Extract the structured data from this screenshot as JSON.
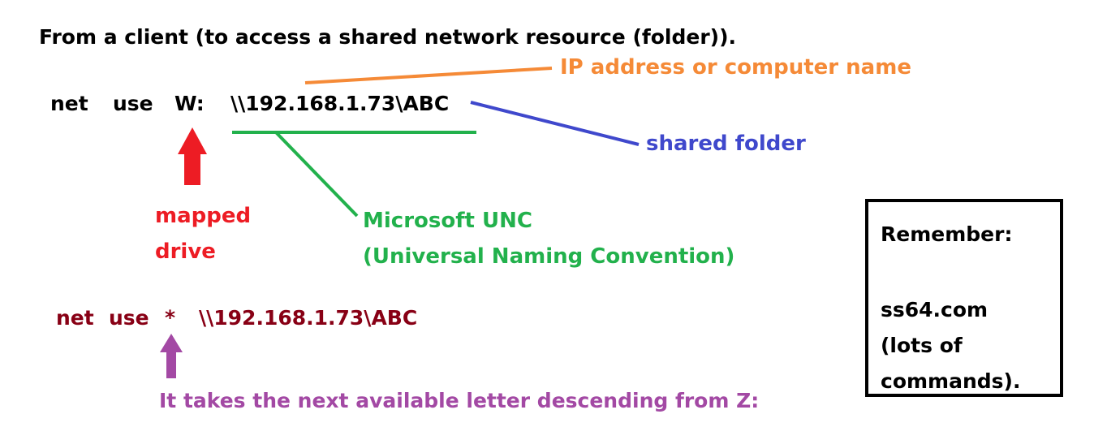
{
  "title": "From a client (to access a shared network resource (folder)).",
  "command1": {
    "net": "net",
    "use": "use",
    "drive": "W:",
    "path": "\\\\192.168.1.73\\ABC"
  },
  "annotations": {
    "ip_label": "IP address or computer name",
    "shared_folder_label": "shared folder",
    "mapped_drive_line1": "mapped",
    "mapped_drive_line2": "drive",
    "unc_line1": "Microsoft UNC",
    "unc_line2": "(Universal Naming Convention)"
  },
  "command2": {
    "net": "net",
    "use": "use",
    "star": "*",
    "path": "\\\\192.168.1.73\\ABC"
  },
  "next_letter_label": "It takes the next available letter descending from Z:",
  "remember": {
    "title": "Remember:",
    "line1": "ss64.com",
    "line2": "(lots of",
    "line3": "commands)."
  },
  "colors": {
    "orange": "#f58a37",
    "blue": "#3f48cc",
    "red": "#ed1c24",
    "green": "#22b14c",
    "dark_red": "#880015",
    "purple": "#a349a4",
    "black": "#000000"
  }
}
